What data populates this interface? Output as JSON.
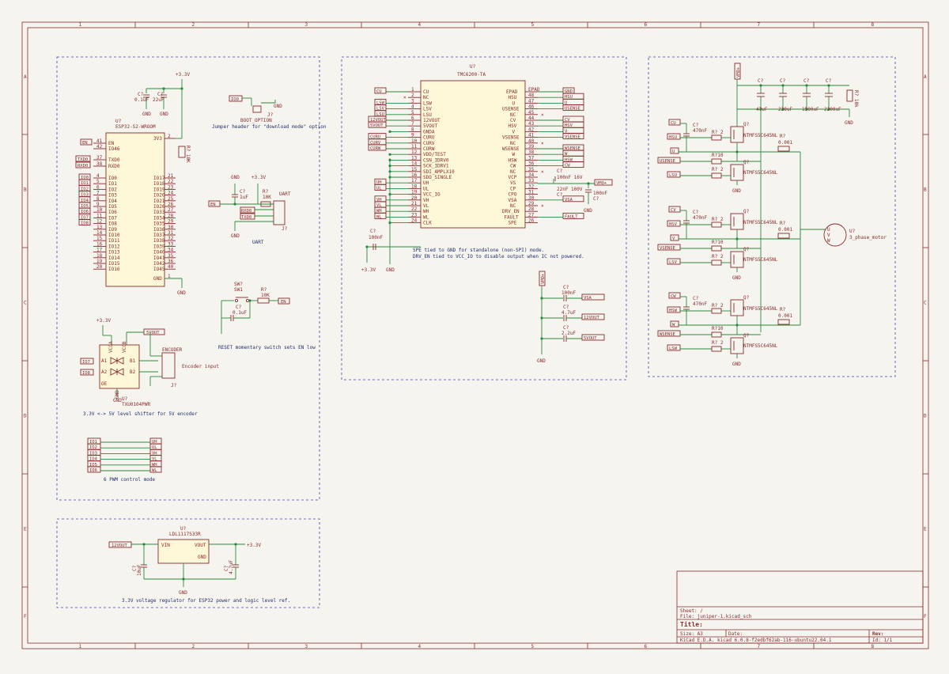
{
  "title_block": {
    "sheet_label": "Sheet: /",
    "file_label": "File: juniper-1.kicad_sch",
    "title_label": "Title:",
    "size_label": "Size: A3",
    "date_label": "Date:",
    "rev_label": "Rev:",
    "tool_label": "KiCad E.D.A.  kicad 6.0.8-f2edbf62ab-116-ubuntu22.04.1",
    "id_label": "Id: 1/1"
  },
  "frame": {
    "columns": [
      "1",
      "2",
      "3",
      "4",
      "5",
      "6",
      "7",
      "8"
    ],
    "rows": [
      "A",
      "B",
      "C",
      "D",
      "E",
      "F"
    ]
  },
  "esp32": {
    "ref": "U?",
    "value": "ESP32-S2-WROOM",
    "supply": "+3.3V",
    "gnd": "GND",
    "c1_ref": "C?",
    "c1_val": "0.1uF",
    "c2_ref": "C?",
    "c2_val": "22uF",
    "r_ref": "R? 10K",
    "left_labels": [
      "EN",
      "TXD0",
      "RXD0",
      "IO0",
      "IO1",
      "IO2",
      "IO3",
      "IO4",
      "IO5",
      "IO6",
      "IO7",
      "IO8"
    ],
    "left_pins_top": [
      "EN",
      "IO46",
      "TXD0",
      "RXD0"
    ],
    "left_pins": [
      "IO0",
      "IO1",
      "IO2",
      "IO3",
      "IO4",
      "IO5",
      "IO6",
      "IO7",
      "IO8",
      "IO9",
      "IO10",
      "IO11",
      "IO12",
      "IO13",
      "IO14",
      "IO15",
      "IO16"
    ],
    "right_pins": [
      "3V3",
      "IO17",
      "IO18",
      "IO19",
      "IO20",
      "IO21",
      "IO26",
      "IO33",
      "IO34",
      "IO35",
      "IO36",
      "IO37",
      "IO38",
      "IO39",
      "IO40",
      "IO41",
      "IO42",
      "IO45",
      "GND"
    ],
    "left_numbers": [
      "41",
      "42",
      "37",
      "38",
      "4",
      "5",
      "6",
      "7",
      "8",
      "9",
      "10",
      "11",
      "12",
      "13",
      "14",
      "15",
      "16",
      "17",
      "18",
      "19",
      "20"
    ],
    "right_numbers": [
      "2",
      "21",
      "22",
      "23",
      "24",
      "25",
      "26",
      "27",
      "28",
      "29",
      "30",
      "31",
      "32",
      "33",
      "34",
      "35",
      "36",
      "40",
      "1"
    ]
  },
  "boot": {
    "label": "IO0",
    "ref": "J?",
    "value": "BOOT_OPTION",
    "gnd": "GND",
    "note": "Jumper header for \"download mode\" option"
  },
  "uart": {
    "supply": "+3.3V",
    "gnd": "GND",
    "c_ref": "C?",
    "c_val": "1uF",
    "r_ref": "R?",
    "r_val": "10K",
    "en": "EN",
    "rxd": "RXD0",
    "txd": "TXD0",
    "conn": "UART",
    "ref": "J?",
    "pins": [
      "1",
      "2",
      "3",
      "4"
    ],
    "note": "UART"
  },
  "reset": {
    "ref": "SW?",
    "value": "SW1",
    "c_ref": "C?",
    "c_val": "0.1uF",
    "r_ref": "R?",
    "r_val": "10K",
    "en": "EN",
    "note": "RESET momentary switch sets EN low"
  },
  "shifter": {
    "supply": "+3.3V",
    "v5": "5VOUT",
    "ref": "U?",
    "value": "TXU0104PWR",
    "pins_left": [
      "A1",
      "A2",
      "OE"
    ],
    "pins_right": [
      "B1",
      "B2"
    ],
    "vcca": "VCCA",
    "vccb": "VCCB",
    "gnd_pin": "GND",
    "in1": "IO7",
    "in2": "IO8",
    "conn": "ENCODER",
    "conn_ref": "J?",
    "conn_note": "Encoder input",
    "gnd": "GND",
    "note": "3.3V <-> 5V level shifter for 5V encoder"
  },
  "pwm": {
    "inputs": [
      "IO1",
      "IO2",
      "IO3",
      "IO4",
      "IO5",
      "IO6"
    ],
    "outputs": [
      "UH",
      "UL",
      "VH",
      "VL",
      "WH",
      "WL"
    ],
    "note": "6 PWM control mode"
  },
  "ldo": {
    "ref": "U?",
    "value": "LDL1117S33R",
    "vin": "VIN",
    "vout": "VOUT",
    "gnd_pin": "GND",
    "in_label": "12VOUT",
    "out_label": "+3.3V",
    "c_in_ref": "C?",
    "c_in_val": "10uF",
    "c_out_ref": "C?",
    "c_out_val": "4.7uF",
    "gnd": "GND",
    "note": "3.3V voltage regulator for ESP32 power and logic level ref."
  },
  "driver": {
    "ref": "U?",
    "value": "TMC6200-TA",
    "left_pins": [
      "CU",
      "NC",
      "LSW",
      "LSV",
      "LSU",
      "12VOUT",
      "5VOUT",
      "GNDA",
      "CURU",
      "CURV",
      "CURW",
      "VDD/TEST",
      "CSN_IDRV0",
      "SCK_IDRV1",
      "SDI_AMPLX10",
      "SDO_SINGLE",
      "UH",
      "UL",
      "VCC_IO",
      "VH",
      "VL",
      "WH",
      "WL",
      "CLK"
    ],
    "left_numbers": [
      "1",
      "2",
      "3",
      "4",
      "5",
      "6",
      "7",
      "8",
      "9",
      "10",
      "11",
      "12",
      "13",
      "14",
      "15",
      "16",
      "17",
      "18",
      "19",
      "20",
      "21",
      "22",
      "23",
      "24"
    ],
    "right_pins": [
      "EPAD",
      "HSU",
      "U",
      "USENSE",
      "NC",
      "CV",
      "HSV",
      "V",
      "VSENSE",
      "NC",
      "WSENSE",
      "W",
      "HSW",
      "CW",
      "NC",
      "VCP",
      "VS",
      "CP",
      "CPO",
      "VSA",
      "NC",
      "DRV_EN",
      "FAULT",
      "SPE"
    ],
    "right_numbers": [
      "EPAD",
      "48",
      "47",
      "46",
      "45",
      "44",
      "43",
      "42",
      "41",
      "40",
      "39",
      "38",
      "37",
      "36",
      "35",
      "34",
      "33",
      "32",
      "31",
      "30",
      "29",
      "28",
      "27",
      "26",
      "25"
    ],
    "left_labels": [
      "CU",
      "LSW",
      "LSV",
      "LSU",
      "12VOUT",
      "5VOUT",
      "CURU",
      "CURV",
      "CURW",
      "UH",
      "UL",
      "VH",
      "VL",
      "WH",
      "WL"
    ],
    "right_labels": [
      "GND",
      "HSU",
      "U",
      "USENSE",
      "CV",
      "HSV",
      "V",
      "VSENSE",
      "W",
      "WSENSE",
      "HSW",
      "CW",
      "VMO+",
      "VSA",
      "FAULT"
    ],
    "c_vcp": "100nF 16V",
    "c_cp": "22nF 100V",
    "c_vs": "100nF",
    "c_ref": "C?",
    "c_io_ref": "C?",
    "c_io_val": "100nF",
    "supply": "+3.3V",
    "gnd": "GND",
    "note1": "SPE tied to GND for standalone (non-SPI) mode.",
    "note2": "DRV_EN tied to VCC_IO to disable output when IC not powered.",
    "vsa_supply": "VMO+",
    "vsa_caps": [
      {
        "ref": "C?",
        "val": "100nF",
        "label": "VSA"
      },
      {
        "ref": "C?",
        "val": "4.7uF",
        "label": "12VOUT"
      },
      {
        "ref": "C?",
        "val": "2.2uF",
        "label": "5VOUT"
      }
    ]
  },
  "power_stage": {
    "supply": "VMO+",
    "bulk_caps": [
      {
        "ref": "C?",
        "val": "47uF"
      },
      {
        "ref": "C?",
        "val": "220uF"
      },
      {
        "ref": "C?",
        "val": "1500uF"
      },
      {
        "ref": "C?",
        "val": "2200uF"
      }
    ],
    "r_bleed": "R? 10k",
    "gnd": "GND",
    "phases": [
      {
        "c_label": "CU",
        "hs_label": "HSU",
        "sw_label": "U",
        "sense_label": "USENSE",
        "ls_label": "LSU",
        "cap": "470nF",
        "r_gate_hs": "R? 2",
        "r_gate_ls": "R? 2",
        "r_sense": "R?10",
        "shunt": "0.001"
      },
      {
        "c_label": "CV",
        "hs_label": "HSV",
        "sw_label": "V",
        "sense_label": "VSENSE",
        "ls_label": "LSV",
        "cap": "470nF",
        "r_gate_hs": "R? 2",
        "r_gate_ls": "R? 2",
        "r_sense": "R?10",
        "shunt": "0.001"
      },
      {
        "c_label": "CW",
        "hs_label": "HSW",
        "sw_label": "W",
        "sense_label": "WSENSE",
        "ls_label": "LSW",
        "cap": "470nF",
        "r_gate_hs": "R? 2",
        "r_gate_ls": "R? 2",
        "r_sense": "R?10",
        "shunt": "0.001"
      }
    ],
    "q_ref": "Q?",
    "q_val": "NTMFS5C645NL",
    "c_ref": "C?",
    "r_ref": "R?",
    "motor_ref": "U?",
    "motor_val": "3_phase_motor",
    "motor_pins": [
      "U",
      "V",
      "W"
    ]
  }
}
